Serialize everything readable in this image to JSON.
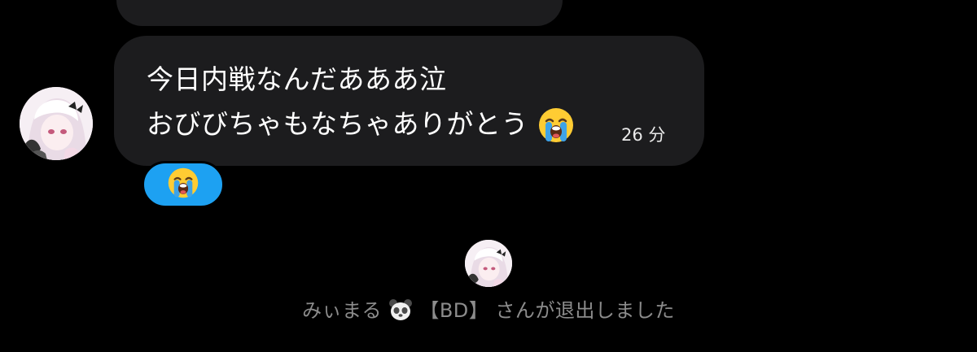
{
  "conversation": {
    "previous_bubble": {
      "visible": "partial"
    },
    "message": {
      "line1": "今日内戦なんだあああ泣",
      "line2": "おびびちゃもなちゃありがとう",
      "emoji_icon": "loudly-crying-face-icon",
      "timestamp": "26 分"
    },
    "reaction": {
      "emoji_icon": "loudly-crying-face-icon",
      "color": "#1da1f2"
    },
    "system": {
      "text_before": "みぃまる",
      "emoji_icon": "panda-face-icon",
      "text_after": "【BD】 さんが退出しました"
    }
  },
  "colors": {
    "background": "#000000",
    "bubble": "#1c1c1e",
    "reaction": "#1da1f2",
    "system_text": "#8c8c8c"
  }
}
